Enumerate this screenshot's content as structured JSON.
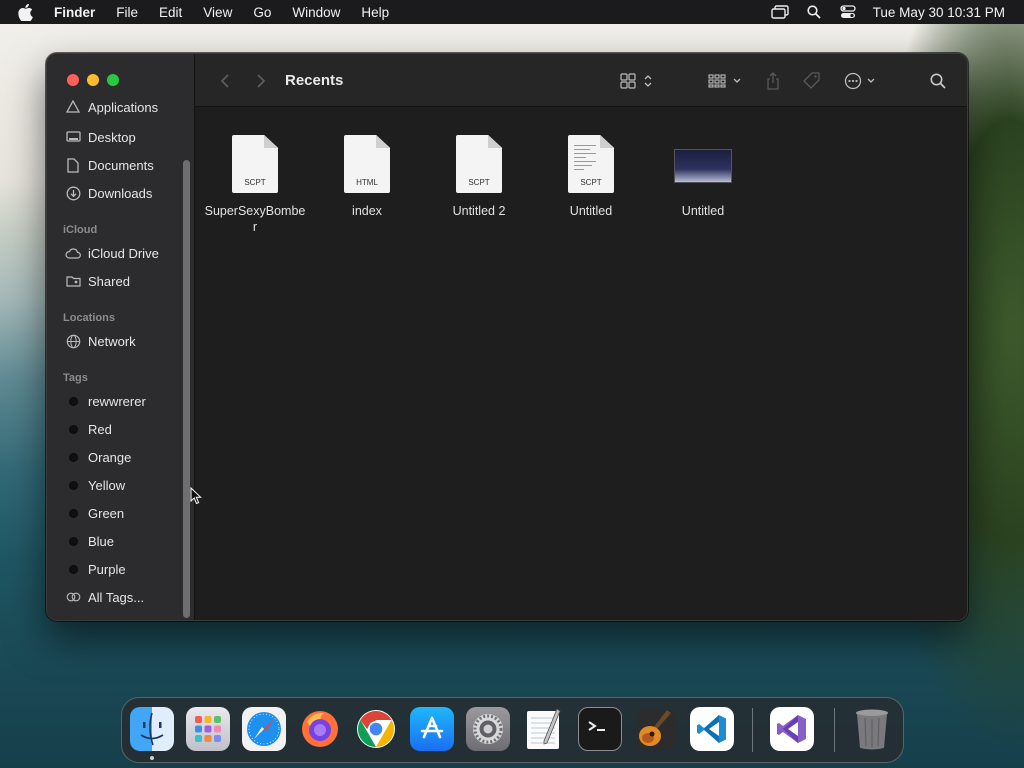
{
  "menubar": {
    "app_name": "Finder",
    "menus": [
      "File",
      "Edit",
      "View",
      "Go",
      "Window",
      "Help"
    ],
    "clock": "Tue May 30  10:31 PM"
  },
  "window": {
    "title": "Recents"
  },
  "sidebar": {
    "favorites": [
      {
        "label": "Applications",
        "icon": "applications-icon"
      },
      {
        "label": "Desktop",
        "icon": "desktop-icon"
      },
      {
        "label": "Documents",
        "icon": "document-icon"
      },
      {
        "label": "Downloads",
        "icon": "download-icon"
      }
    ],
    "icloud_heading": "iCloud",
    "icloud": [
      {
        "label": "iCloud Drive",
        "icon": "cloud-icon"
      },
      {
        "label": "Shared",
        "icon": "shared-folder-icon"
      }
    ],
    "locations_heading": "Locations",
    "locations": [
      {
        "label": "Network",
        "icon": "globe-icon"
      }
    ],
    "tags_heading": "Tags",
    "tags": [
      "rewwrerer",
      "Red",
      "Orange",
      "Yellow",
      "Green",
      "Blue",
      "Purple"
    ],
    "all_tags": "All Tags..."
  },
  "files": [
    {
      "name": "SuperSexyBomber",
      "ext": "SCPT",
      "kind": "script"
    },
    {
      "name": "index",
      "ext": "HTML",
      "kind": "html"
    },
    {
      "name": "Untitled 2",
      "ext": "SCPT",
      "kind": "script"
    },
    {
      "name": "Untitled",
      "ext": "SCPT",
      "kind": "script-lines"
    },
    {
      "name": "Untitled",
      "ext": "",
      "kind": "screenshot"
    }
  ],
  "dock": [
    "Finder",
    "Launchpad",
    "Safari",
    "Firefox",
    "Chrome",
    "App Store",
    "System Settings",
    "TextEdit",
    "Terminal",
    "GarageBand",
    "Visual Studio Code",
    "Visual Studio",
    "Trash"
  ],
  "colors": {
    "close": "#fe5f57",
    "minimize": "#febc2e",
    "maximize": "#28c840",
    "sidebar_bg": "#2c2c2e",
    "window_bg": "#1e1e1e"
  }
}
